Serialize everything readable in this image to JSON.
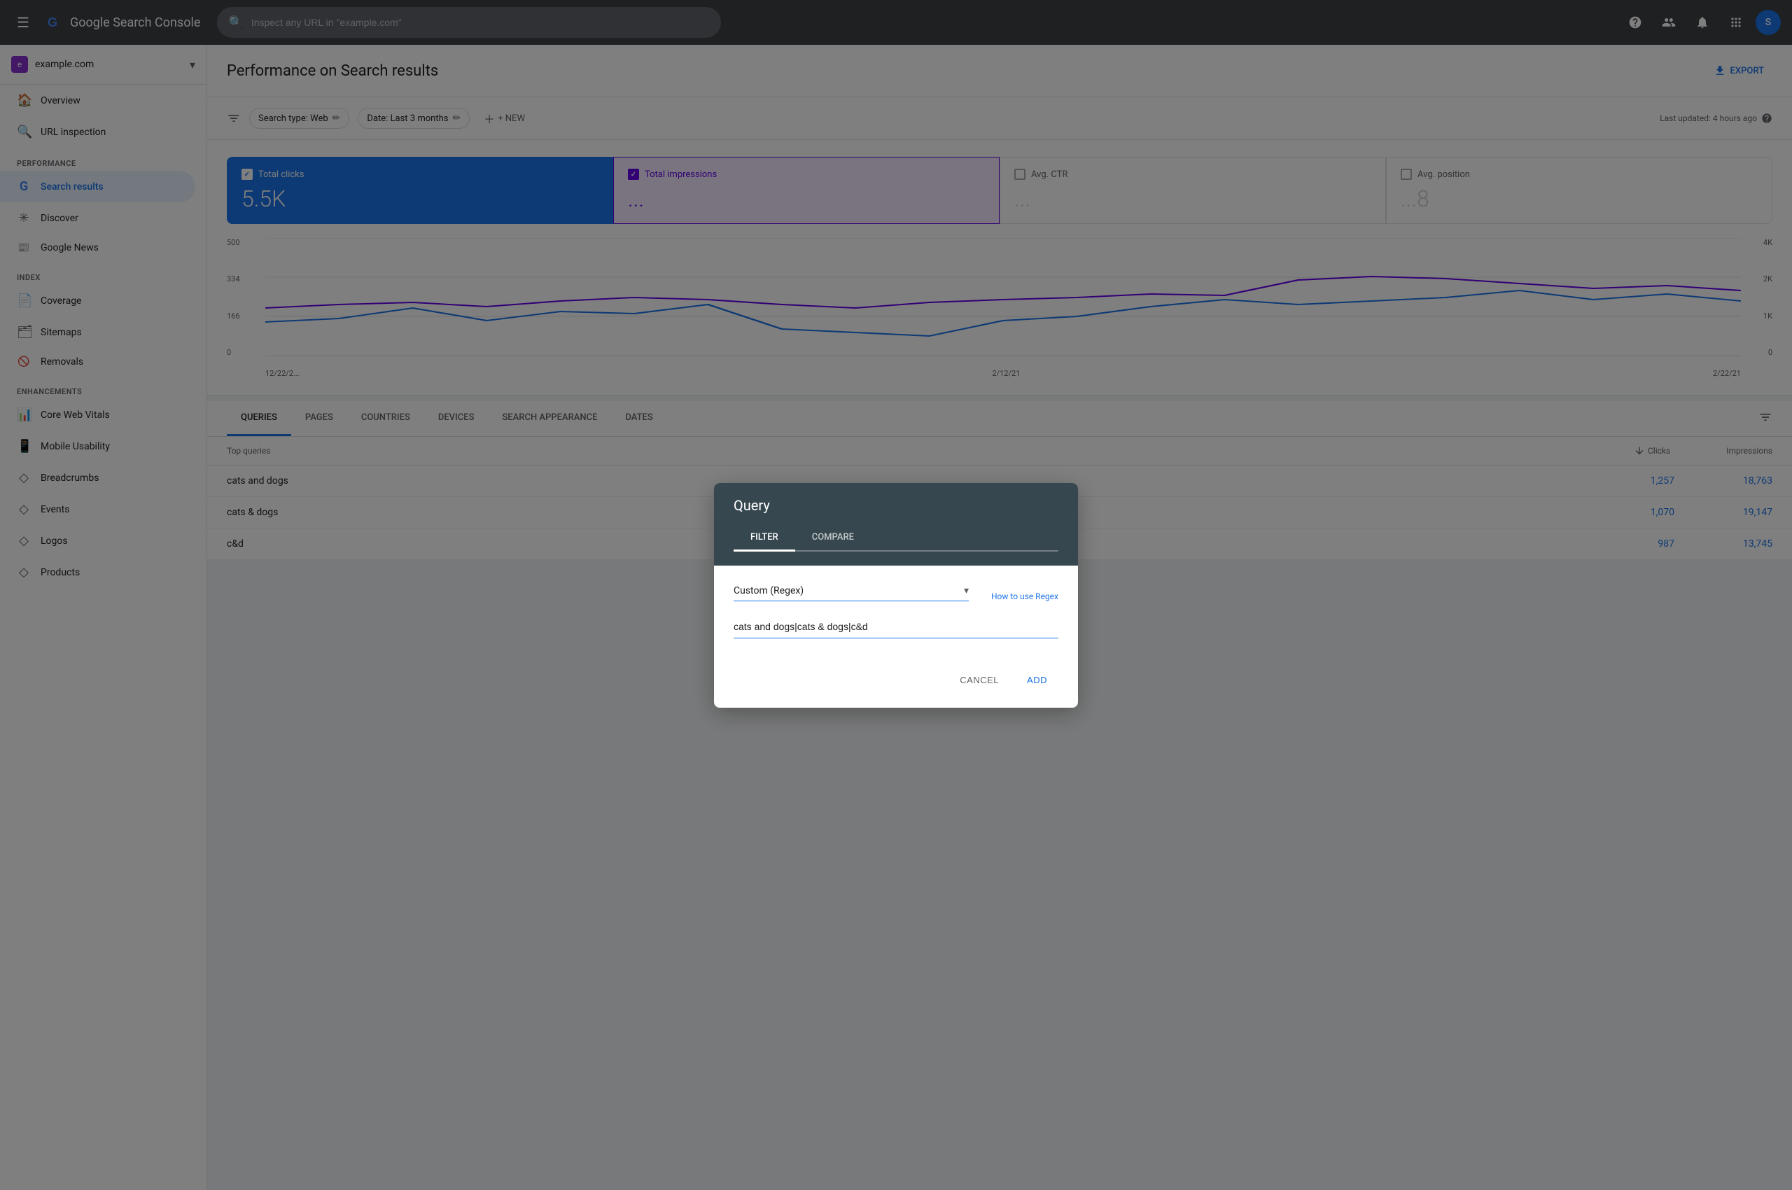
{
  "topbar": {
    "menu_icon": "☰",
    "logo_text": "Google Search Console",
    "search_placeholder": "Inspect any URL in \"example.com\"",
    "help_icon": "?",
    "accounts_icon": "👤",
    "notifications_icon": "🔔",
    "apps_icon": "⋮⋮",
    "avatar_text": "S"
  },
  "sidebar": {
    "property": {
      "name": "example.com",
      "icon_text": "e"
    },
    "nav_items": [
      {
        "id": "overview",
        "label": "Overview",
        "icon": "🏠"
      },
      {
        "id": "url-inspection",
        "label": "URL inspection",
        "icon": "🔍"
      }
    ],
    "sections": [
      {
        "header": "Performance",
        "items": [
          {
            "id": "search-results",
            "label": "Search results",
            "icon": "G",
            "active": true
          },
          {
            "id": "discover",
            "label": "Discover",
            "icon": "✳"
          },
          {
            "id": "google-news",
            "label": "Google News",
            "icon": "📰"
          }
        ]
      },
      {
        "header": "Index",
        "items": [
          {
            "id": "coverage",
            "label": "Coverage",
            "icon": "📄"
          },
          {
            "id": "sitemaps",
            "label": "Sitemaps",
            "icon": "🗂"
          },
          {
            "id": "removals",
            "label": "Removals",
            "icon": "🚫"
          }
        ]
      },
      {
        "header": "Enhancements",
        "items": [
          {
            "id": "core-web-vitals",
            "label": "Core Web Vitals",
            "icon": "📊"
          },
          {
            "id": "mobile-usability",
            "label": "Mobile Usability",
            "icon": "📱"
          },
          {
            "id": "breadcrumbs",
            "label": "Breadcrumbs",
            "icon": "◇"
          },
          {
            "id": "events",
            "label": "Events",
            "icon": "◇"
          },
          {
            "id": "logos",
            "label": "Logos",
            "icon": "◇"
          },
          {
            "id": "products",
            "label": "Products",
            "icon": "◇"
          }
        ]
      }
    ]
  },
  "page": {
    "title": "Performance on Search results",
    "export_label": "EXPORT",
    "last_updated": "Last updated: 4 hours ago"
  },
  "filters": {
    "filter_icon": "⚙",
    "chips": [
      {
        "label": "Search type: Web",
        "editable": true
      },
      {
        "label": "Date: Last 3 months",
        "editable": true
      }
    ],
    "add_label": "+ NEW"
  },
  "metrics": [
    {
      "id": "total-clicks",
      "label": "Total clicks",
      "value": "5.5K",
      "checked": true,
      "active": true
    },
    {
      "id": "total-impressions",
      "label": "Total impressions",
      "value": "...",
      "checked": true,
      "active": true
    },
    {
      "id": "avg-ctr",
      "label": "Avg. CTR",
      "value": "...",
      "checked": false,
      "active": false
    },
    {
      "id": "avg-position",
      "label": "Avg. position",
      "value": "...8",
      "checked": false,
      "active": false
    }
  ],
  "chart": {
    "y_labels_left": [
      "500",
      "334",
      "166",
      "0"
    ],
    "y_labels_right": [
      "4K",
      "2K",
      "1K",
      "0"
    ],
    "x_labels": [
      "12/22/2...",
      "2/12/21",
      "2/22/21"
    ]
  },
  "tabs": {
    "items": [
      {
        "id": "queries",
        "label": "QUERIES",
        "active": true
      },
      {
        "id": "pages",
        "label": "PAGES",
        "active": false
      },
      {
        "id": "countries",
        "label": "COUNTRIES",
        "active": false
      },
      {
        "id": "devices",
        "label": "DEVICES",
        "active": false
      },
      {
        "id": "search-appearance",
        "label": "SEARCH APPEARANCE",
        "active": false
      },
      {
        "id": "dates",
        "label": "DATES",
        "active": false
      }
    ]
  },
  "table": {
    "header": {
      "label": "Top queries",
      "clicks": "Clicks",
      "impressions": "Impressions"
    },
    "rows": [
      {
        "query": "cats and dogs",
        "clicks": "1,257",
        "impressions": "18,763"
      },
      {
        "query": "cats & dogs",
        "clicks": "1,070",
        "impressions": "19,147"
      },
      {
        "query": "c&d",
        "clicks": "987",
        "impressions": "13,745"
      }
    ]
  },
  "modal": {
    "title": "Query",
    "tabs": [
      {
        "label": "FILTER",
        "active": true
      },
      {
        "label": "COMPARE",
        "active": false
      }
    ],
    "select_label": "Custom (Regex)",
    "how_to_use_label": "How to use Regex",
    "input_value": "cats and dogs|cats & dogs|c&d",
    "input_placeholder": "",
    "cancel_label": "CANCEL",
    "add_label": "ADD"
  }
}
